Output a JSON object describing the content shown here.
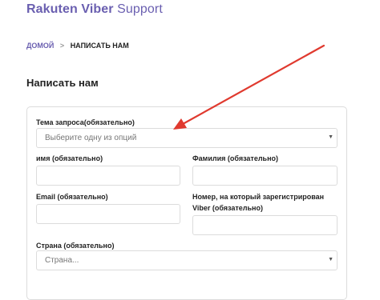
{
  "header": {
    "brand": "Rakuten Viber",
    "product": " Support"
  },
  "breadcrumb": {
    "home": "ДОМОЙ",
    "separator": ">",
    "current": "НАПИСАТЬ НАМ"
  },
  "page": {
    "title": "Написать нам"
  },
  "form": {
    "topic_label": "Тема запроса(обязательно)",
    "topic_placeholder": "Выберите одну из опций",
    "first_name_label": "имя (обязательно)",
    "last_name_label": "Фамилия (обязательно)",
    "email_label": "Email (обязательно)",
    "phone_label_line1": "Номер, на который зарегистрирован",
    "phone_label_line2": "Viber (обязательно)",
    "country_label": "Страна (обязательно)",
    "country_placeholder": "Страна..."
  },
  "colors": {
    "brand": "#6a5fb0",
    "arrow": "#e03a2f"
  }
}
